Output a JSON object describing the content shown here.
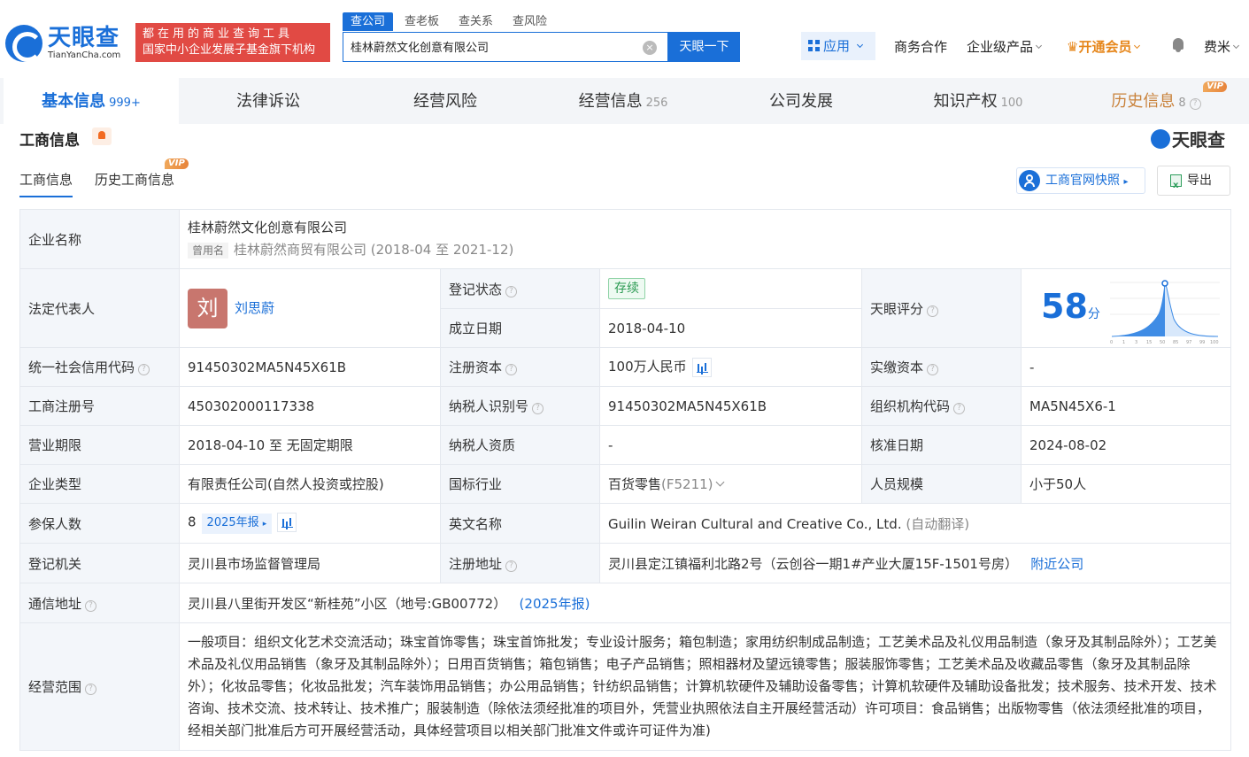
{
  "header": {
    "logo_cn": "天眼查",
    "logo_en": "TianYanCha.com",
    "promo_line1": "都在用的商业查询工具",
    "promo_line2": "国家中小企业发展子基金旗下机构",
    "search_tabs": [
      "查公司",
      "查老板",
      "查关系",
      "查风险"
    ],
    "search_value": "桂林蔚然文化创意有限公司",
    "clear_symbol": "×",
    "search_button": "天眼一下",
    "apps_label": "应用",
    "nav": {
      "business": "商务合作",
      "enterprise": "企业级产品",
      "vip": "开通会员",
      "user": "费米"
    }
  },
  "main_tabs": [
    {
      "label": "基本信息",
      "count": "999+"
    },
    {
      "label": "法律诉讼",
      "count": ""
    },
    {
      "label": "经营风险",
      "count": ""
    },
    {
      "label": "经营信息",
      "count": "256"
    },
    {
      "label": "公司发展",
      "count": ""
    },
    {
      "label": "知识产权",
      "count": "100"
    },
    {
      "label": "历史信息",
      "count": "8"
    }
  ],
  "vip_label": "VIP",
  "section": {
    "title": "工商信息",
    "brand": "天眼查",
    "sub_tabs": [
      "工商信息",
      "历史工商信息"
    ],
    "snapshot_button": "工商官网快照",
    "export_button": "导出"
  },
  "company": {
    "name_label": "企业名称",
    "name": "桂林蔚然文化创意有限公司",
    "former_tag": "曾用名",
    "former_name": "桂林蔚然商贸有限公司 (2018-04 至 2021-12)",
    "legal_rep_label": "法定代表人",
    "legal_rep_avatar": "刘",
    "legal_rep": "刘思蔚",
    "reg_status_label": "登记状态",
    "reg_status": "存续",
    "founded_label": "成立日期",
    "founded": "2018-04-10",
    "score_label": "天眼评分",
    "score": "58",
    "score_unit": "分",
    "score_ticks": [
      "0",
      "1",
      "3",
      "15",
      "50",
      "85",
      "97",
      "99",
      "100"
    ],
    "credit_code_label": "统一社会信用代码",
    "credit_code": "91450302MA5N45X61B",
    "reg_capital_label": "注册资本",
    "reg_capital": "100万人民币",
    "paid_capital_label": "实缴资本",
    "paid_capital": "-",
    "reg_no_label": "工商注册号",
    "reg_no": "450302000117338",
    "taxpayer_id_label": "纳税人识别号",
    "taxpayer_id": "91450302MA5N45X61B",
    "org_code_label": "组织机构代码",
    "org_code": "MA5N45X6-1",
    "term_label": "营业期限",
    "term": "2018-04-10 至 无固定期限",
    "taxpayer_qual_label": "纳税人资质",
    "taxpayer_qual": "-",
    "approval_date_label": "核准日期",
    "approval_date": "2024-08-02",
    "type_label": "企业类型",
    "type": "有限责任公司(自然人投资或控股)",
    "industry_label": "国标行业",
    "industry": "百货零售",
    "industry_code": "(F5211)",
    "staff_size_label": "人员规模",
    "staff_size": "小于50人",
    "insured_label": "参保人数",
    "insured": "8",
    "insured_year": "2025年报",
    "english_name_label": "英文名称",
    "english_name": "Guilin Weiran Cultural and Creative Co., Ltd.",
    "english_name_note": "(自动翻译)",
    "authority_label": "登记机关",
    "authority": "灵川县市场监督管理局",
    "reg_address_label": "注册地址",
    "reg_address": "灵川县定江镇福利北路2号（云创谷一期1#产业大厦15F-1501号房）",
    "nearby_link": "附近公司",
    "mail_address_label": "通信地址",
    "mail_address": "灵川县八里街开发区“新桂苑”小区（地号:GB00772）",
    "mail_address_year": "(2025年报)",
    "scope_label": "经营范围",
    "scope": "一般项目：组织文化艺术交流活动；珠宝首饰零售；珠宝首饰批发；专业设计服务；箱包制造；家用纺织制成品制造；工艺美术品及礼仪用品制造（象牙及其制品除外）；工艺美术品及礼仪用品销售（象牙及其制品除外）；日用百货销售；箱包销售；电子产品销售；照相器材及望远镜零售；服装服饰零售；工艺美术品及收藏品零售（象牙及其制品除外）；化妆品零售；化妆品批发；汽车装饰用品销售；办公用品销售；针纺织品销售；计算机软硬件及辅助设备零售；计算机软硬件及辅助设备批发；技术服务、技术开发、技术咨询、技术交流、技术转让、技术推广；服装制造（除依法须经批准的项目外，凭营业执照依法自主开展经营活动）许可项目：食品销售；出版物零售（依法须经批准的项目，经相关部门批准后方可开展经营活动，具体经营项目以相关部门批准文件或许可证件为准)"
  },
  "colors": {
    "brand_blue": "#1a6fd8",
    "promo_red": "#e14a44",
    "status_green": "#2b9a52",
    "vip_orange": "#e6861a"
  }
}
